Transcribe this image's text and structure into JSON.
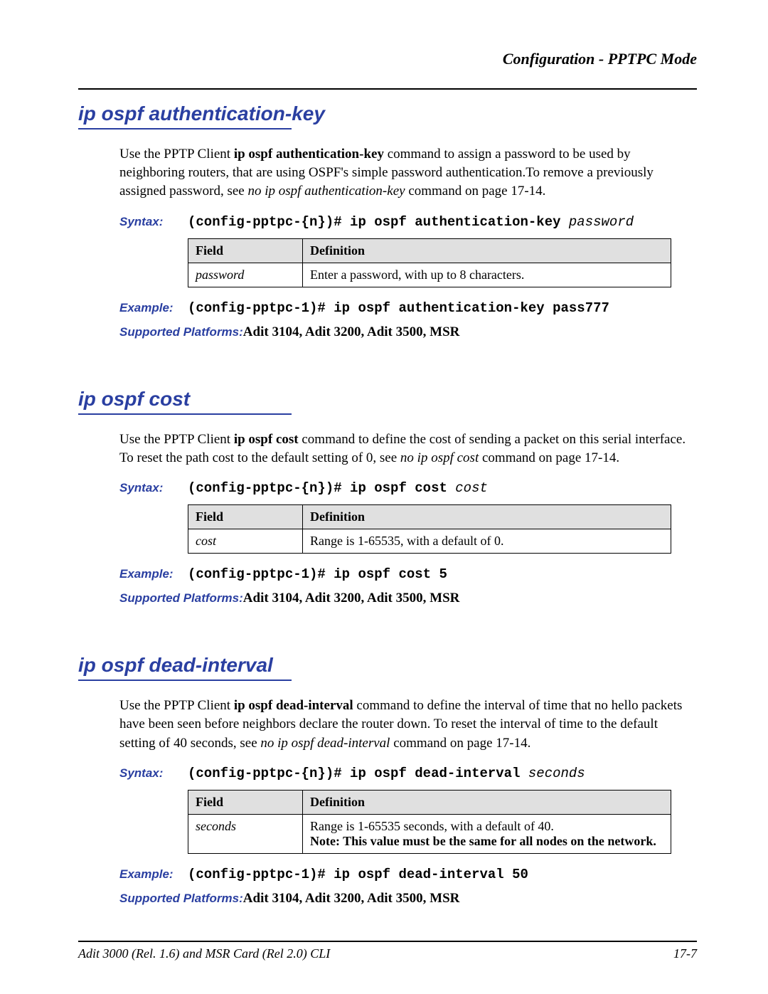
{
  "running_header": "Configuration - PPTPC Mode",
  "sections": [
    {
      "heading": "ip ospf authentication-key",
      "intro_pre": "Use the PPTP Client ",
      "intro_cmd": "ip ospf authentication-key",
      "intro_post1": " command to assign a password to be used by neighboring routers, that are using OSPF's simple password authentication.To remove a previously assigned password, see ",
      "intro_ref": "no ip ospf authentication-key",
      "intro_post2": " command on page 17-14.",
      "syntax_label": "Syntax:",
      "syntax_prefix": "(config-pptpc-{n})# ",
      "syntax_cmd": "ip ospf authentication-key ",
      "syntax_param": "password",
      "table_h1": "Field",
      "table_h2": "Definition",
      "table_field": "password",
      "table_def": "Enter a password, with up to 8 characters.",
      "table_def_note": "",
      "example_label": "Example:",
      "example": "(config-pptpc-1)# ip ospf authentication-key pass777",
      "platforms_label": "Supported Platforms:  ",
      "platforms": "Adit 3104, Adit 3200, Adit 3500, MSR"
    },
    {
      "heading": "ip ospf cost",
      "intro_pre": "Use the PPTP Client ",
      "intro_cmd": "ip ospf cost",
      "intro_post1": " command to define the cost of sending a packet on this serial interface. To reset the path cost to the default setting of 0, see ",
      "intro_ref": "no ip ospf cost",
      "intro_post2": " command on page 17-14.",
      "syntax_label": "Syntax:",
      "syntax_prefix": "(config-pptpc-{n})# ",
      "syntax_cmd": "ip ospf cost ",
      "syntax_param": "cost",
      "table_h1": "Field",
      "table_h2": "Definition",
      "table_field": "cost",
      "table_def": "Range is 1-65535, with a default of 0.",
      "table_def_note": "",
      "example_label": "Example:",
      "example": "(config-pptpc-1)# ip ospf cost 5",
      "platforms_label": "Supported Platforms:  ",
      "platforms": "Adit 3104, Adit 3200, Adit 3500, MSR"
    },
    {
      "heading": "ip ospf dead-interval",
      "intro_pre": "Use the PPTP Client ",
      "intro_cmd": "ip ospf dead-interval",
      "intro_post1": " command to define the interval of time that no hello packets have been seen before neighbors declare the router down. To reset the interval of time to the default setting of 40 seconds, see ",
      "intro_ref": "no ip ospf dead-interval",
      "intro_post2": " command on page 17-14.",
      "syntax_label": "Syntax:",
      "syntax_prefix": "(config-pptpc-{n})# ",
      "syntax_cmd": "ip ospf dead-interval ",
      "syntax_param": "seconds",
      "table_h1": "Field",
      "table_h2": "Definition",
      "table_field": "seconds",
      "table_def": "Range is 1-65535 seconds, with a default of 40.",
      "table_def_note": "Note: This value must be the same for all nodes on the network.",
      "example_label": "Example:",
      "example": "(config-pptpc-1)# ip ospf dead-interval 50",
      "platforms_label": "Supported Platforms:  ",
      "platforms": "Adit 3104, Adit 3200, Adit 3500, MSR"
    }
  ],
  "footer_left": "Adit 3000 (Rel. 1.6) and MSR Card (Rel 2.0) CLI",
  "footer_right": "17-7"
}
